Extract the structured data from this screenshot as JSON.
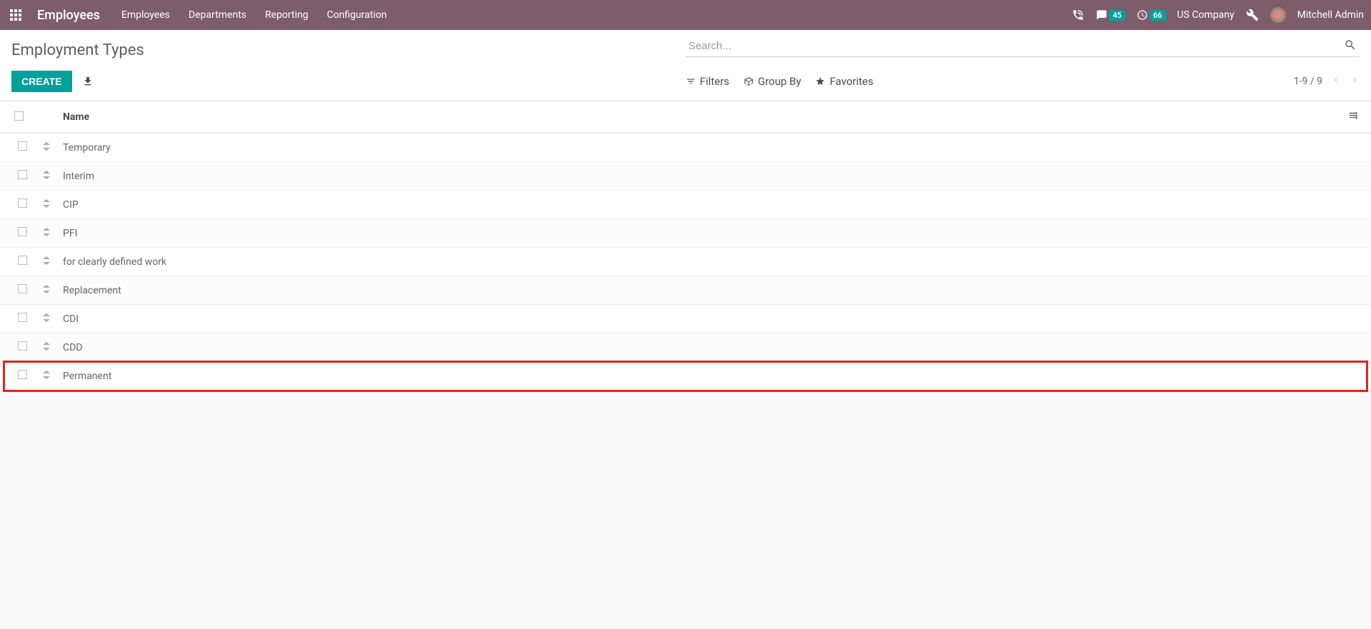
{
  "topbar": {
    "app_name": "Employees",
    "nav": [
      "Employees",
      "Departments",
      "Reporting",
      "Configuration"
    ],
    "messages_count": "45",
    "activities_count": "66",
    "company": "US Company",
    "user": "Mitchell Admin"
  },
  "page": {
    "title": "Employment Types",
    "search_placeholder": "Search...",
    "create_label": "CREATE",
    "filters_label": "Filters",
    "groupby_label": "Group By",
    "favorites_label": "Favorites",
    "pager": "1-9 / 9"
  },
  "table": {
    "header_name": "Name",
    "rows": [
      {
        "name": "Temporary"
      },
      {
        "name": "Interim"
      },
      {
        "name": "CIP"
      },
      {
        "name": "PFI"
      },
      {
        "name": "for clearly defined work"
      },
      {
        "name": "Replacement"
      },
      {
        "name": "CDI"
      },
      {
        "name": "CDD"
      },
      {
        "name": "Permanent"
      }
    ]
  }
}
